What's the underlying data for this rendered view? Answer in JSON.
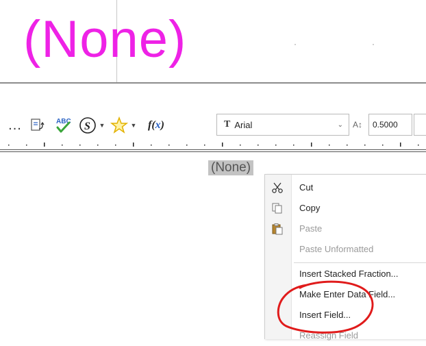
{
  "canvas_top": {
    "text": "(None)",
    "text_color": "#ee22e6"
  },
  "toolbar": {
    "more_label": "...",
    "font_name": "Arial",
    "font_icon": "T",
    "text_height": "0.5000",
    "icons": [
      "insert-field-icon",
      "spell-check-icon",
      "symbol-icon",
      "star-icon",
      "function-icon"
    ]
  },
  "canvas": {
    "selected_text": "(None)"
  },
  "context_menu": {
    "items": [
      {
        "label": "Cut",
        "icon": "scissors-icon",
        "enabled": true
      },
      {
        "label": "Copy",
        "icon": "copy-icon",
        "enabled": true
      },
      {
        "label": "Paste",
        "icon": "paste-icon",
        "enabled": false
      },
      {
        "label": "Paste Unformatted",
        "enabled": false
      },
      {
        "label": "Insert Stacked Fraction...",
        "enabled": true
      },
      {
        "label": "Make Enter Data Field...",
        "enabled": true
      },
      {
        "label": "Insert Field...",
        "enabled": true
      },
      {
        "label": "Reassign Field",
        "enabled": false
      }
    ]
  },
  "annotation": {
    "color": "#e01b1b",
    "shape": "circle"
  }
}
